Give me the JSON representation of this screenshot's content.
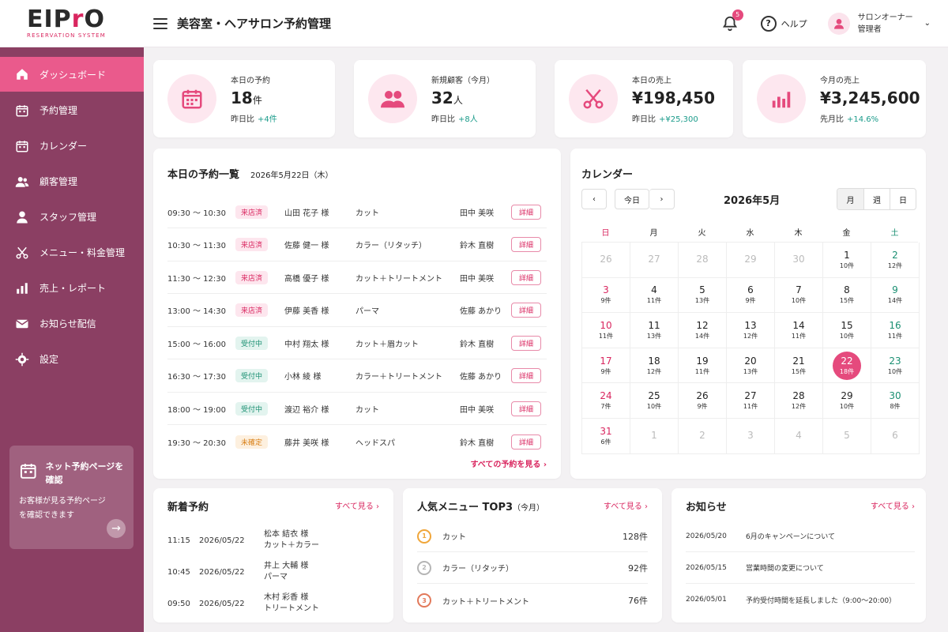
{
  "app": {
    "logo_main_a": "EIP",
    "logo_main_b": "r",
    "logo_main_c": "O",
    "logo_sub": "RESERVATION SYSTEM",
    "title": "美容室・ヘアサロン予約管理"
  },
  "header": {
    "notification_count": "5",
    "help_label": "ヘルプ",
    "user_role": "サロンオーナー",
    "user_name": "管理者"
  },
  "sidebar": {
    "items": [
      {
        "label": "ダッシュボード",
        "icon": "home-icon"
      },
      {
        "label": "予約管理",
        "icon": "calendar-icon"
      },
      {
        "label": "カレンダー",
        "icon": "calendar-icon"
      },
      {
        "label": "顧客管理",
        "icon": "users-icon"
      },
      {
        "label": "スタッフ管理",
        "icon": "user-icon"
      },
      {
        "label": "メニュー・料金管理",
        "icon": "scissors-icon"
      },
      {
        "label": "売上・レポート",
        "icon": "bar-chart-icon"
      },
      {
        "label": "お知らせ配信",
        "icon": "mail-icon"
      },
      {
        "label": "設定",
        "icon": "gear-icon"
      }
    ],
    "promo_title": "ネット予約ページを確認",
    "promo_desc": "お客様が見る予約ページを確認できます"
  },
  "stats": [
    {
      "label": "本日の予約",
      "value": "18",
      "unit": "件",
      "diff_label": "昨日比",
      "diff": "+4件",
      "icon": "calendar-icon"
    },
    {
      "label": "新規顧客（今月）",
      "value": "32",
      "unit": "人",
      "diff_label": "昨日比",
      "diff": "+8人",
      "icon": "users-icon"
    },
    {
      "label": "本日の売上",
      "value": "¥198,450",
      "unit": "",
      "diff_label": "昨日比",
      "diff": "+¥25,300",
      "icon": "scissors-icon"
    },
    {
      "label": "今月の売上",
      "value": "¥3,245,600",
      "unit": "",
      "diff_label": "先月比",
      "diff": "+14.6%",
      "icon": "bar-chart-icon"
    }
  ],
  "reservations": {
    "title": "本日の予約一覧",
    "date": "2026年5月22日（木）",
    "detail_label": "詳細",
    "see_all": "すべての予約を見る ›",
    "rows": [
      {
        "time": "09:30 ～ 10:30",
        "status": "来店済",
        "status_type": "done",
        "name": "山田 花子 様",
        "menu": "カット",
        "staff": "田中 美咲"
      },
      {
        "time": "10:30 ～ 11:30",
        "status": "来店済",
        "status_type": "done",
        "name": "佐藤 健一 様",
        "menu": "カラー（リタッチ）",
        "staff": "鈴木 直樹"
      },
      {
        "time": "11:30 ～ 12:30",
        "status": "来店済",
        "status_type": "done",
        "name": "高橋 優子 様",
        "menu": "カット＋トリートメント",
        "staff": "田中 美咲"
      },
      {
        "time": "13:00 ～ 14:30",
        "status": "来店済",
        "status_type": "done",
        "name": "伊藤 美香 様",
        "menu": "パーマ",
        "staff": "佐藤 あかり"
      },
      {
        "time": "15:00 ～ 16:00",
        "status": "受付中",
        "status_type": "wait",
        "name": "中村 翔太 様",
        "menu": "カット＋眉カット",
        "staff": "鈴木 直樹"
      },
      {
        "time": "16:30 ～ 17:30",
        "status": "受付中",
        "status_type": "wait",
        "name": "小林 綾 様",
        "menu": "カラー＋トリートメント",
        "staff": "佐藤 あかり"
      },
      {
        "time": "18:00 ～ 19:00",
        "status": "受付中",
        "status_type": "wait",
        "name": "渡辺 裕介 様",
        "menu": "カット",
        "staff": "田中 美咲"
      },
      {
        "time": "19:30 ～ 20:30",
        "status": "未確定",
        "status_type": "pend",
        "name": "藤井 美咲 様",
        "menu": "ヘッドスパ",
        "staff": "鈴木 直樹"
      }
    ]
  },
  "calendar": {
    "title": "カレンダー",
    "today_label": "今日",
    "month_label": "2026年5月",
    "view_month": "月",
    "view_week": "週",
    "view_day": "日",
    "weekdays": [
      "日",
      "月",
      "火",
      "水",
      "木",
      "金",
      "土"
    ],
    "cells": [
      {
        "d": "26",
        "c": "",
        "other": true
      },
      {
        "d": "27",
        "c": "",
        "other": true
      },
      {
        "d": "28",
        "c": "",
        "other": true
      },
      {
        "d": "29",
        "c": "",
        "other": true
      },
      {
        "d": "30",
        "c": "",
        "other": true
      },
      {
        "d": "1",
        "c": "10件"
      },
      {
        "d": "2",
        "c": "12件"
      },
      {
        "d": "3",
        "c": "9件"
      },
      {
        "d": "4",
        "c": "11件"
      },
      {
        "d": "5",
        "c": "13件"
      },
      {
        "d": "6",
        "c": "9件"
      },
      {
        "d": "7",
        "c": "10件"
      },
      {
        "d": "8",
        "c": "15件"
      },
      {
        "d": "9",
        "c": "14件"
      },
      {
        "d": "10",
        "c": "11件"
      },
      {
        "d": "11",
        "c": "13件"
      },
      {
        "d": "12",
        "c": "14件"
      },
      {
        "d": "13",
        "c": "12件"
      },
      {
        "d": "14",
        "c": "11件"
      },
      {
        "d": "15",
        "c": "10件"
      },
      {
        "d": "16",
        "c": "11件"
      },
      {
        "d": "17",
        "c": "9件"
      },
      {
        "d": "18",
        "c": "12件"
      },
      {
        "d": "19",
        "c": "11件"
      },
      {
        "d": "20",
        "c": "13件"
      },
      {
        "d": "21",
        "c": "15件"
      },
      {
        "d": "22",
        "c": "18件",
        "today": true
      },
      {
        "d": "23",
        "c": "10件"
      },
      {
        "d": "24",
        "c": "7件"
      },
      {
        "d": "25",
        "c": "10件"
      },
      {
        "d": "26",
        "c": "9件"
      },
      {
        "d": "27",
        "c": "11件"
      },
      {
        "d": "28",
        "c": "12件"
      },
      {
        "d": "29",
        "c": "10件"
      },
      {
        "d": "30",
        "c": "8件"
      },
      {
        "d": "31",
        "c": "6件"
      },
      {
        "d": "1",
        "c": "",
        "other": true
      },
      {
        "d": "2",
        "c": "",
        "other": true
      },
      {
        "d": "3",
        "c": "",
        "other": true
      },
      {
        "d": "4",
        "c": "",
        "other": true
      },
      {
        "d": "5",
        "c": "",
        "other": true
      },
      {
        "d": "6",
        "c": "",
        "other": true
      }
    ]
  },
  "new_reservations": {
    "title": "新着予約",
    "see_all": "すべて見る ›",
    "rows": [
      {
        "time": "11:15",
        "date": "2026/05/22",
        "name": "松本 結衣 様",
        "menu": "カット＋カラー"
      },
      {
        "time": "10:45",
        "date": "2026/05/22",
        "name": "井上 大輔 様",
        "menu": "パーマ"
      },
      {
        "time": "09:50",
        "date": "2026/05/22",
        "name": "木村 彩香 様",
        "menu": "トリートメント"
      }
    ]
  },
  "popular_menu": {
    "title": "人気メニュー TOP3",
    "subtitle": "（今月）",
    "see_all": "すべて見る ›",
    "rows": [
      {
        "rank": "1",
        "name": "カット",
        "count": "128件",
        "color": "#f0a63a"
      },
      {
        "rank": "2",
        "name": "カラー（リタッチ）",
        "count": "92件",
        "color": "#b5b5b5"
      },
      {
        "rank": "3",
        "name": "カット＋トリートメント",
        "count": "76件",
        "color": "#e2795a"
      }
    ]
  },
  "notices": {
    "title": "お知らせ",
    "see_all": "すべて見る ›",
    "rows": [
      {
        "date": "2026/05/20",
        "text": "6月のキャンペーンについて"
      },
      {
        "date": "2026/05/15",
        "text": "営業時間の変更について"
      },
      {
        "date": "2026/05/01",
        "text": "予約受付時間を延長しました（9:00〜20:00）"
      }
    ]
  },
  "colors": {
    "accent": "#e54a7d",
    "sidebar": "#8b3f63",
    "positive": "#1a9b8a"
  }
}
